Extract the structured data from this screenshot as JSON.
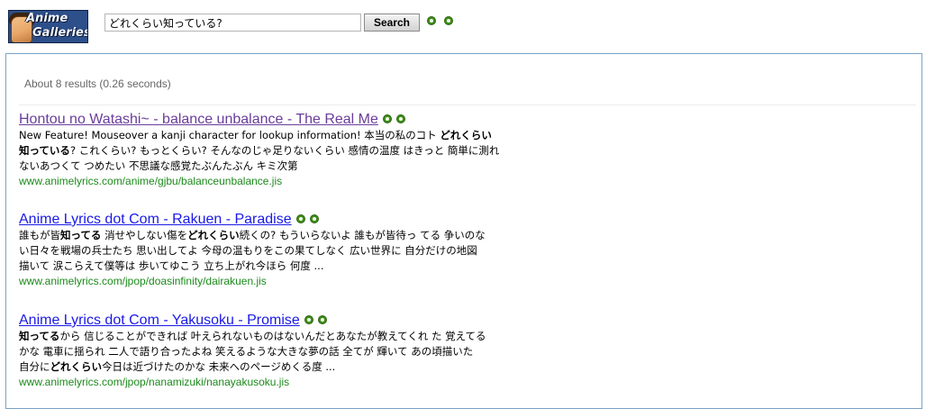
{
  "header": {
    "logo_line1": "Anime",
    "logo_line2": "Galleries",
    "search_value": "どれくらい知っている?",
    "search_button_label": "Search",
    "icons": [
      "green-dot-icon",
      "green-dot-icon"
    ]
  },
  "results_info": "About 8 results (0.26 seconds)",
  "colors": {
    "visited_link": "#6a3d9a",
    "link": "#1a1ae6",
    "url": "#1b8a1b",
    "box_border": "#7aa3c7"
  },
  "results": [
    {
      "title": "Hontou no Watashi~ - balance unbalance - The Real Me",
      "visited": true,
      "lines": [
        [
          {
            "t": "New Feature! Mouseover a kanji character for lookup information! 本当の私のコト ",
            "b": false
          },
          {
            "t": "どれくらい",
            "b": true
          }
        ],
        [
          {
            "t": "知っている",
            "b": true
          },
          {
            "t": "? これくらい? もっとくらい? そんなのじゃ足りないくらい 感情の温度 はきっと 簡単に測れ",
            "b": false
          }
        ],
        [
          {
            "t": "ないあつくて つめたい 不思議な感覚たぶんたぶん キミ次第",
            "b": false
          }
        ]
      ],
      "url": "www.animelyrics.com/anime/gjbu/balanceunbalance.jis"
    },
    {
      "title": "Anime Lyrics dot Com - Rakuen - Paradise",
      "visited": false,
      "lines": [
        [
          {
            "t": "誰もが皆",
            "b": false
          },
          {
            "t": "知ってる",
            "b": true
          },
          {
            "t": " 消せやしない傷を",
            "b": false
          },
          {
            "t": "どれくらい",
            "b": true
          },
          {
            "t": "続くの? もういらないよ 誰もが皆待っ てる 争いのな",
            "b": false
          }
        ],
        [
          {
            "t": "い日々を戦場の兵士たち 思い出してよ 今母の温もりをこの果てしなく 広い世界に 自分だけの地図",
            "b": false
          }
        ],
        [
          {
            "t": "描いて 涙こらえて僕等は 歩いてゆこう 立ち上がれ今ほら 何度 ...",
            "b": false
          }
        ]
      ],
      "url": "www.animelyrics.com/jpop/doasinfinity/dairakuen.jis"
    },
    {
      "title": "Anime Lyrics dot Com - Yakusoku - Promise",
      "visited": false,
      "lines": [
        [
          {
            "t": "知ってる",
            "b": true
          },
          {
            "t": "から 信じることができれば 叶えられないものはないんだとあなたが教えてくれ た 覚えてる",
            "b": false
          }
        ],
        [
          {
            "t": "かな 電車に揺られ 二人で語り合ったよね 笑えるような大きな夢の話 全てが 輝いて あの頃描いた",
            "b": false
          }
        ],
        [
          {
            "t": "自分に",
            "b": false
          },
          {
            "t": "どれくらい",
            "b": true
          },
          {
            "t": "今日は近づけたのかな 未来へのページめくる度 ...",
            "b": false
          }
        ]
      ],
      "url": "www.animelyrics.com/jpop/nanamizuki/nanayakusoku.jis"
    }
  ]
}
